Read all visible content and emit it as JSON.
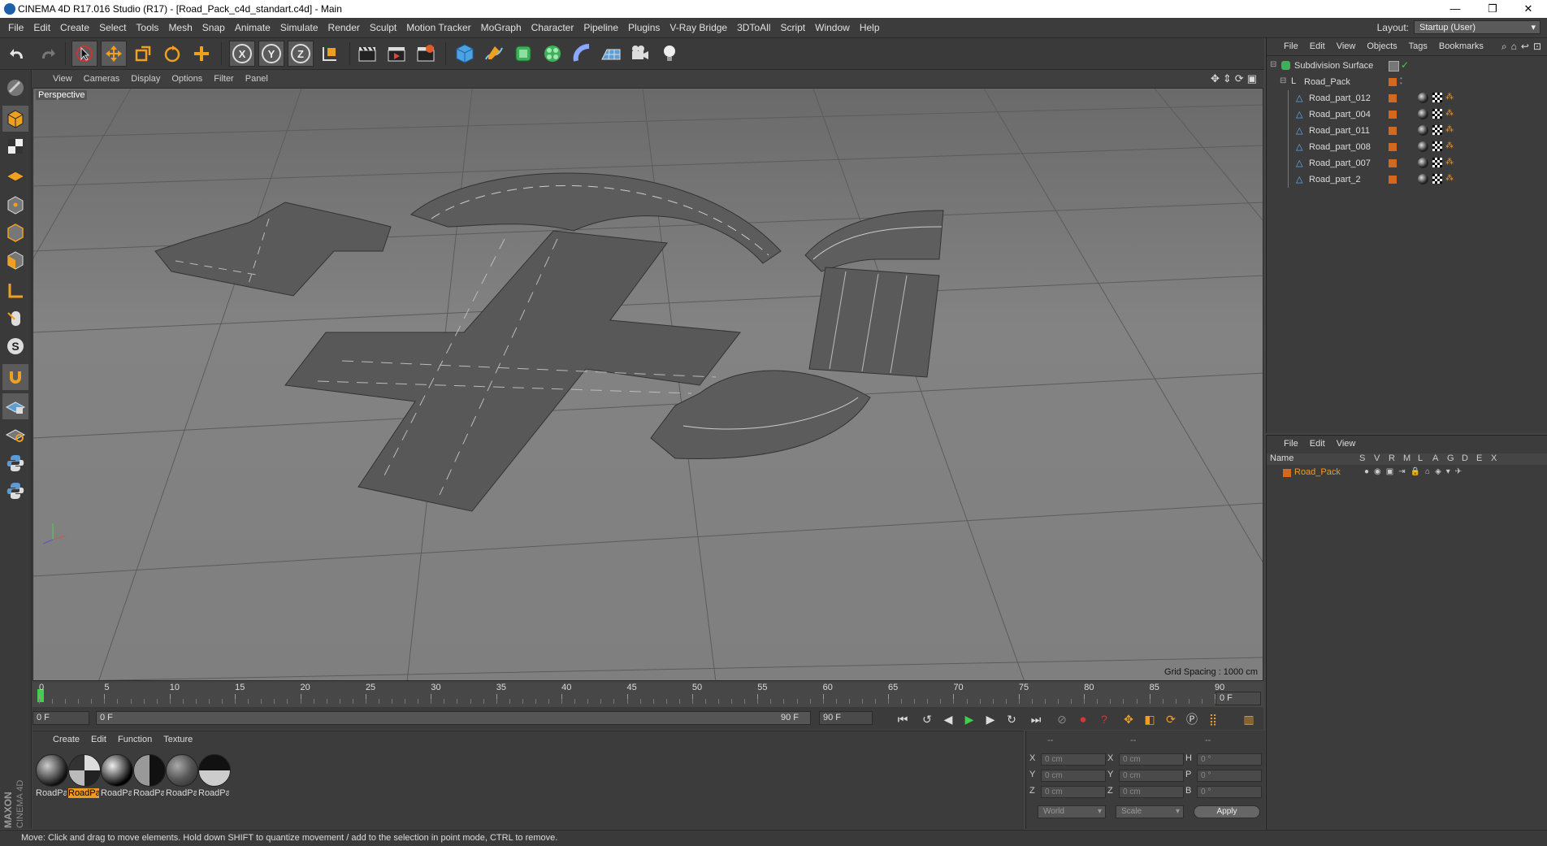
{
  "window": {
    "title": "CINEMA 4D R17.016 Studio (R17) - [Road_Pack_c4d_standart.c4d] - Main",
    "minimize": "—",
    "maximize": "❐",
    "close": "✕"
  },
  "menubar": {
    "items": [
      "File",
      "Edit",
      "Create",
      "Select",
      "Tools",
      "Mesh",
      "Snap",
      "Animate",
      "Simulate",
      "Render",
      "Sculpt",
      "Motion Tracker",
      "MoGraph",
      "Character",
      "Pipeline",
      "Plugins",
      "V-Ray Bridge",
      "3DToAll",
      "Script",
      "Window",
      "Help"
    ],
    "layout_label": "Layout:",
    "layout_value": "Startup (User)"
  },
  "toolbar": {
    "x_label": "X",
    "y_label": "Y",
    "z_label": "Z"
  },
  "viewport": {
    "menu": [
      "View",
      "Cameras",
      "Display",
      "Options",
      "Filter",
      "Panel"
    ],
    "label": "Perspective",
    "grid_spacing": "Grid Spacing : 1000 cm"
  },
  "timeline": {
    "ticks": [
      "0",
      "5",
      "10",
      "15",
      "20",
      "25",
      "30",
      "35",
      "40",
      "45",
      "50",
      "55",
      "60",
      "65",
      "70",
      "75",
      "80",
      "85",
      "90"
    ],
    "current_frame": "0 F",
    "start_field": "0 F",
    "range_start": "0 F",
    "range_end": "90 F",
    "end_field": "90 F"
  },
  "materials": {
    "menu": [
      "Create",
      "Edit",
      "Function",
      "Texture"
    ],
    "items": [
      "RoadPart",
      "RoadPart",
      "RoadPart",
      "RoadPart",
      "RoadPart",
      "RoadPart"
    ],
    "active_index": 1
  },
  "coords": {
    "header_dashes": [
      "--",
      "--",
      "--"
    ],
    "rows": [
      {
        "a": "X",
        "av": "0 cm",
        "b": "X",
        "bv": "0 cm",
        "c": "H",
        "cv": "0 °"
      },
      {
        "a": "Y",
        "av": "0 cm",
        "b": "Y",
        "bv": "0 cm",
        "c": "P",
        "cv": "0 °"
      },
      {
        "a": "Z",
        "av": "0 cm",
        "b": "Z",
        "bv": "0 cm",
        "c": "B",
        "cv": "0 °"
      }
    ],
    "world": "World",
    "scale": "Scale",
    "apply": "Apply"
  },
  "objects": {
    "menu": [
      "File",
      "Edit",
      "View",
      "Objects",
      "Tags",
      "Bookmarks"
    ],
    "root": "Subdivision Surface",
    "group": "Road_Pack",
    "children": [
      "Road_part_012",
      "Road_part_004",
      "Road_part_011",
      "Road_part_008",
      "Road_part_007",
      "Road_part_2"
    ]
  },
  "layers": {
    "menu": [
      "File",
      "Edit",
      "View"
    ],
    "name_header": "Name",
    "cols": [
      "S",
      "V",
      "R",
      "M",
      "L",
      "A",
      "G",
      "D",
      "E",
      "X"
    ],
    "row": "Road_Pack"
  },
  "status": {
    "text": "Move: Click and drag to move elements. Hold down SHIFT to quantize movement / add to the selection in point mode, CTRL to remove."
  },
  "brand": {
    "maxon": "MAXON",
    "product": "CINEMA 4D"
  },
  "colors": {
    "accent": "#f09a22",
    "bg": "#3c3c3c"
  }
}
